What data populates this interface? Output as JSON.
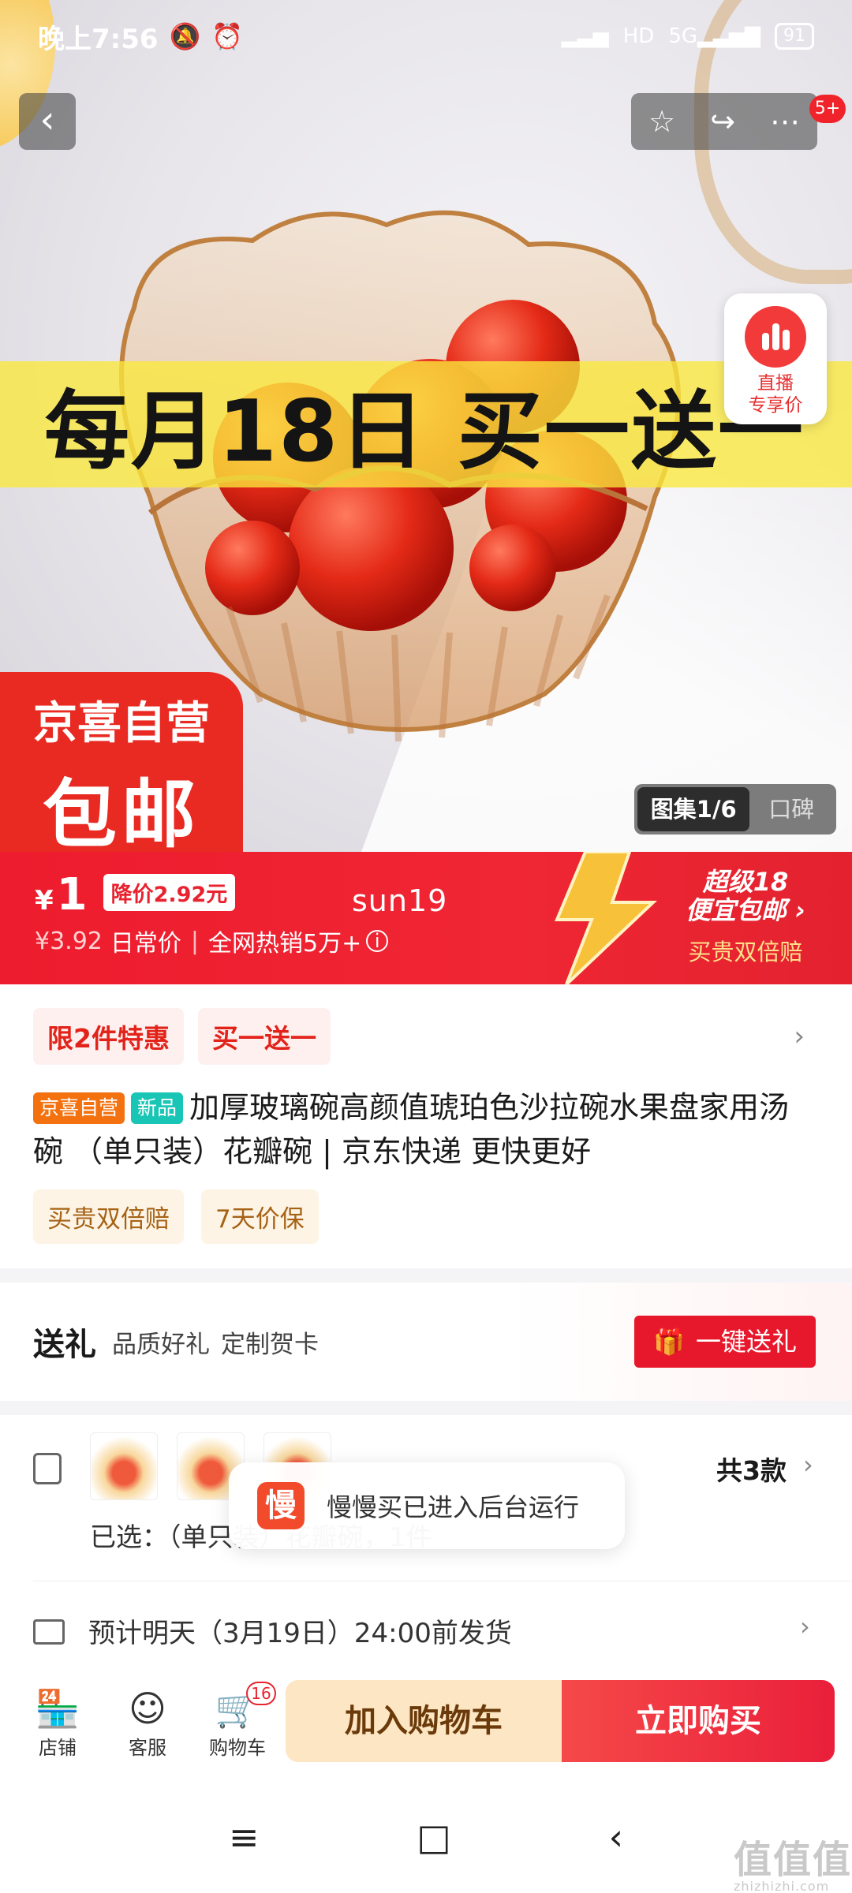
{
  "status_bar": {
    "time": "晚上7:56",
    "left_icons": [
      "mute-icon",
      "alarm-icon"
    ],
    "right_icons": [
      "signal-icon",
      "hd-icon",
      "5g-signal-icon"
    ],
    "network_label": "HD",
    "network_type": "5G",
    "battery": "91"
  },
  "top_nav": {
    "back_icon": "‹",
    "actions": [
      "favorite-star-icon",
      "share-icon",
      "more-icon"
    ],
    "more_badge": "5+"
  },
  "hero": {
    "promo_banner": "每月18日 买一送一",
    "live_card": {
      "line1": "直播",
      "line2": "专享价"
    },
    "jx_badge": {
      "line1": "京喜自营",
      "line2": "包邮"
    },
    "gallery_tabs": [
      "图集1/6",
      "口碑"
    ]
  },
  "price_bar": {
    "currency": "¥",
    "price": "1",
    "drop_tag": "降价2.92元",
    "old_price": "¥3.92",
    "daily_label": "日常价",
    "separator": "|",
    "sales": "全网热销5万+",
    "user_text": "sun19",
    "right_line1": "超级18",
    "right_line2": "便宜包邮",
    "right_line3": "买贵双倍赔"
  },
  "promotions": [
    "限2件特惠",
    "买一送一"
  ],
  "product": {
    "tag_self": "京喜自营",
    "tag_new": "新品",
    "title": "加厚玻璃碗高颜值琥珀色沙拉碗水果盘家用汤碗 （单只装）花瓣碗 | 京东快递 更快更好",
    "service_tags": [
      "买贵双倍赔",
      "7天价保"
    ]
  },
  "gift": {
    "title": "送礼",
    "sub1": "品质好礼",
    "sub2": "定制贺卡",
    "button": "一键送礼"
  },
  "spec": {
    "count_label": "共3款",
    "selected_label": "已选：（单只装）花瓣碗，1件"
  },
  "shipping": {
    "text": "预计明天（3月19日）24:00前发货"
  },
  "toast": {
    "logo": "慢",
    "message": "慢慢买已进入后台运行"
  },
  "bottom_bar": {
    "store": "店铺",
    "service": "客服",
    "cart": "购物车",
    "cart_count": "16",
    "add_cart": "加入购物车",
    "buy_now": "立即购买"
  },
  "system_nav": [
    "≡",
    "□",
    "‹"
  ],
  "watermark": {
    "big": "值值值",
    "small": "zhizhizhi.com"
  },
  "colors": {
    "accent": "#E8232F",
    "promo_yellow": "#FAE83C",
    "gold_text": "#6B3A0B"
  }
}
